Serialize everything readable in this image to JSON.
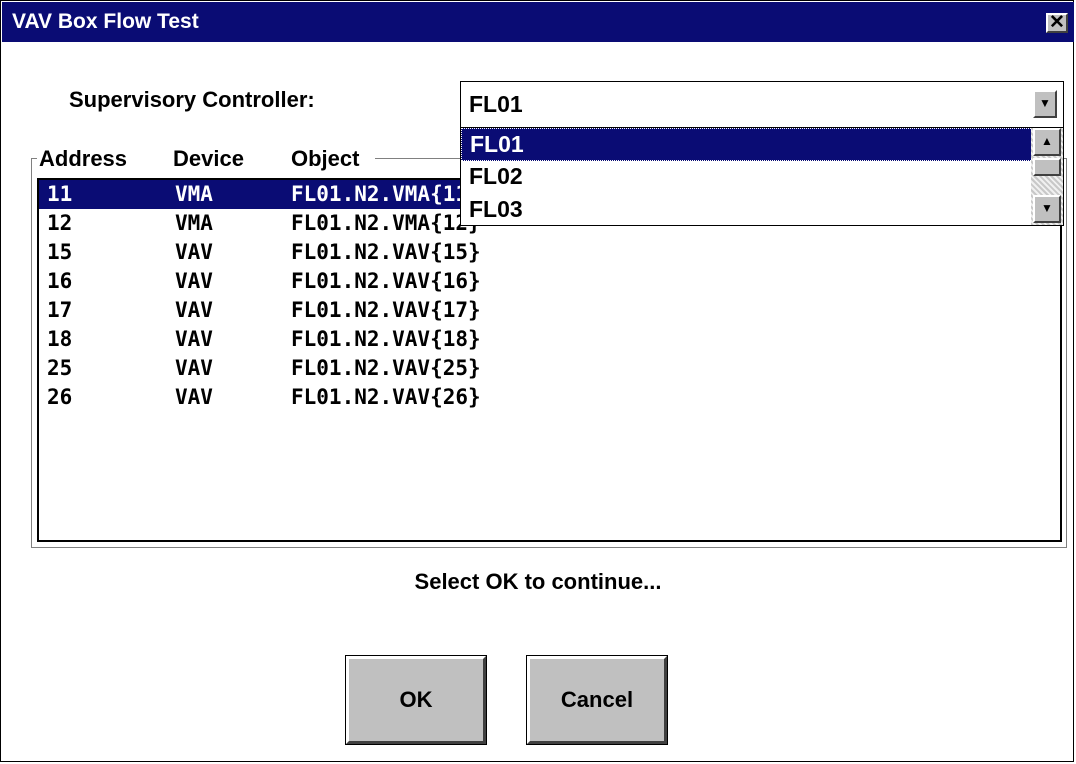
{
  "window": {
    "title": "VAV Box Flow Test",
    "close_glyph": "✕"
  },
  "supervisory": {
    "label": "Supervisory Controller:",
    "selected": "FL01",
    "options": [
      "FL01",
      "FL02",
      "FL03"
    ],
    "highlighted_index": 0
  },
  "list": {
    "columns": [
      "Address",
      "Device",
      "Object"
    ],
    "rows": [
      {
        "address": "11",
        "device": "VMA",
        "object": "FL01.N2.VMA{11}"
      },
      {
        "address": "12",
        "device": "VMA",
        "object": "FL01.N2.VMA{12}"
      },
      {
        "address": "15",
        "device": "VAV",
        "object": "FL01.N2.VAV{15}"
      },
      {
        "address": "16",
        "device": "VAV",
        "object": "FL01.N2.VAV{16}"
      },
      {
        "address": "17",
        "device": "VAV",
        "object": "FL01.N2.VAV{17}"
      },
      {
        "address": "18",
        "device": "VAV",
        "object": "FL01.N2.VAV{18}"
      },
      {
        "address": "25",
        "device": "VAV",
        "object": "FL01.N2.VAV{25}"
      },
      {
        "address": "26",
        "device": "VAV",
        "object": "FL01.N2.VAV{26}"
      }
    ],
    "selected_index": 0
  },
  "status_text": "Select OK to continue...",
  "buttons": {
    "ok": "OK",
    "cancel": "Cancel"
  },
  "icons": {
    "close": "close-icon",
    "dropdown_arrow": "chevron-down-icon",
    "scroll_up": "chevron-up-icon",
    "scroll_down": "chevron-down-icon"
  },
  "colors": {
    "titlebar": "#0a0c74",
    "selection": "#0a0c74",
    "button_face": "#c0c0c0"
  }
}
